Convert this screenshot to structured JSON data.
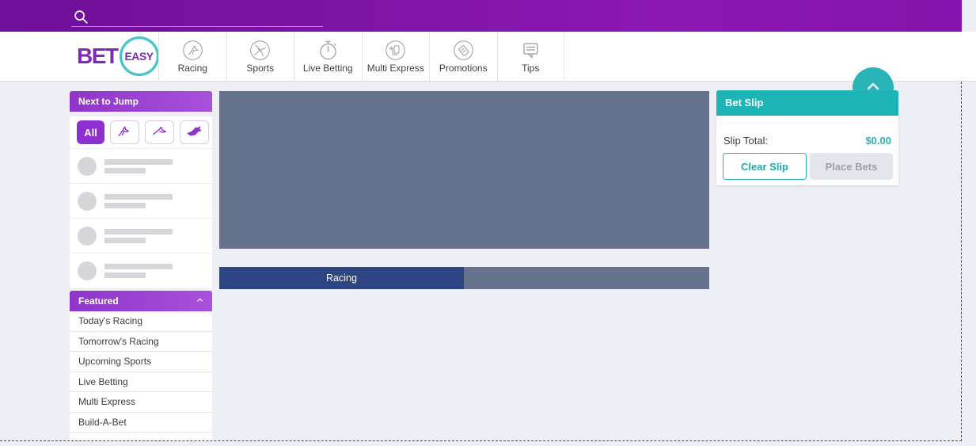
{
  "brand": {
    "bet": "BET",
    "easy": "EASY"
  },
  "topbar": {
    "search_icon": "search-icon",
    "search_value": "",
    "search_placeholder": ""
  },
  "header": {
    "scroll_top_icon": "chevron-up-icon"
  },
  "nav": {
    "items": [
      {
        "label": "Racing",
        "icon": "horse-icon"
      },
      {
        "label": "Sports",
        "icon": "ball-icon"
      },
      {
        "label": "Live Betting",
        "icon": "stopwatch-icon"
      },
      {
        "label": "Multi Express",
        "icon": "pages-icon"
      },
      {
        "label": "Promotions",
        "icon": "ticket-icon"
      },
      {
        "label": "Tips",
        "icon": "speech-bubble-icon"
      }
    ]
  },
  "sidebar": {
    "next_to_jump": {
      "title": "Next to Jump",
      "filters": [
        {
          "label": "All",
          "icon": null,
          "active": true
        },
        {
          "label": "",
          "icon": "gallops-icon",
          "active": false
        },
        {
          "label": "",
          "icon": "harness-icon",
          "active": false
        },
        {
          "label": "",
          "icon": "greyhound-icon",
          "active": false
        }
      ],
      "skeleton_rows": 4
    },
    "featured": {
      "title": "Featured",
      "collapse_icon": "chevron-up-icon",
      "items": [
        "Today's Racing",
        "Tomorrow's Racing",
        "Upcoming Sports",
        "Live Betting",
        "Multi Express",
        "Build-A-Bet"
      ]
    }
  },
  "main": {
    "tabs": [
      {
        "label": "Racing",
        "active": true
      }
    ]
  },
  "betslip": {
    "title": "Bet Slip",
    "total_label": "Slip Total:",
    "total_value": "$0.00",
    "clear_label": "Clear Slip",
    "place_label": "Place Bets"
  },
  "colors": {
    "topbar_purple": "#7b12a3",
    "sidebar_purple": "#9a44ce",
    "filter_purple": "#8e2fd0",
    "teal": "#1cb4b4",
    "banner_slate": "#67738e",
    "tab_navy": "#2e4583",
    "background": "#edeff5"
  }
}
